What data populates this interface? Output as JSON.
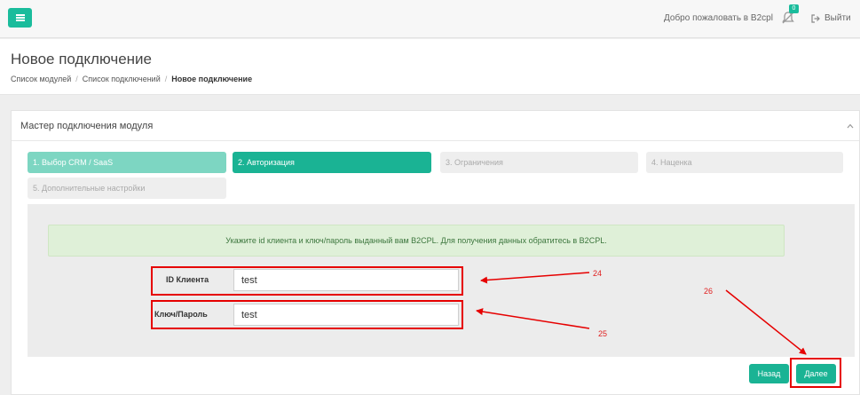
{
  "header": {
    "menu_icon": "hamburger-icon",
    "welcome": "Добро пожаловать в B2cpl",
    "notifications_count": "0",
    "notifications_icon": "bell-slash-icon",
    "logout_label": "Выйти",
    "logout_icon": "sign-out-icon"
  },
  "page": {
    "title": "Новое подключение",
    "breadcrumb": [
      "Список модулей",
      "Список подключений",
      "Новое подключение"
    ],
    "breadcrumb_sep": "/"
  },
  "wizard": {
    "title": "Мастер подключения модуля",
    "collapse_icon": "chevron-up-icon",
    "steps": [
      {
        "label": "1. Выбор CRM / SaaS",
        "state": "done"
      },
      {
        "label": "2. Авторизация",
        "state": "active"
      },
      {
        "label": "3. Ограничения",
        "state": "disabled"
      },
      {
        "label": "4. Наценка",
        "state": "disabled"
      },
      {
        "label": "5. Дополнительные настройки",
        "state": "disabled"
      }
    ],
    "alert": "Укажите id клиента и ключ/пароль выданный вам B2CPL. Для получения данных обратитесь в B2CPL.",
    "fields": {
      "client_id": {
        "label": "ID Клиента",
        "value": "test"
      },
      "key": {
        "label": "Ключ/Пароль",
        "value": "test"
      }
    },
    "back_label": "Назад",
    "next_label": "Далее"
  },
  "annotations": [
    "24",
    "25",
    "26"
  ],
  "colors": {
    "accent": "#1ab394",
    "annotation": "#e60000"
  }
}
